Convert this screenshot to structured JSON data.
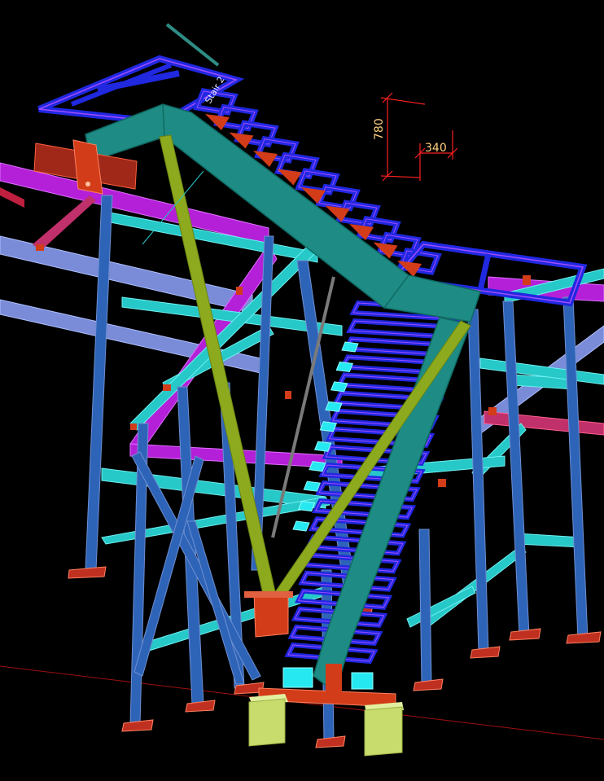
{
  "viewport": {
    "background": "#000000"
  },
  "colors": {
    "frame_blue": "#2E64B8",
    "frame_outline": "#6E8FD0",
    "stringer_teal": "#1E8C84",
    "stringer_dark": "#0F6A63",
    "brace_olive": "#8DAA1E",
    "beam_cyan": "#26C8C8",
    "beam_magenta": "#B420D8",
    "tread_blue": "#2028E0",
    "plate_red": "#D23C18",
    "footing_yellow": "#C8DC6E",
    "dim_red": "#FF2020",
    "dim_text": "#FFD080",
    "grey_beam": "#7A8BD8"
  },
  "dimensions": {
    "rise_label": "780",
    "going_label": "340"
  },
  "stair_labels": {
    "top_flight_text": "Stair 2"
  }
}
